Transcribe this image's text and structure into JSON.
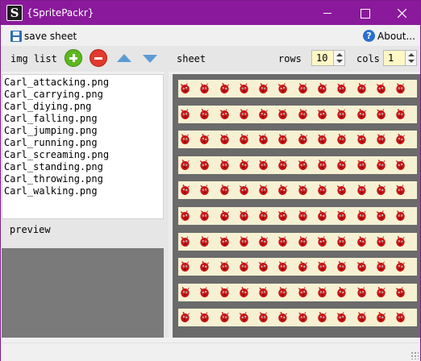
{
  "window": {
    "title": "{SpritePackr}",
    "app_icon_letter": "S"
  },
  "menubar": {
    "save_label": "save sheet",
    "about_label": "About..."
  },
  "toolbar": {
    "img_list_label": "img list",
    "sheet_label": "sheet",
    "rows_label": "rows",
    "rows_value": "10",
    "cols_label": "cols",
    "cols_value": "1"
  },
  "file_list": [
    "Carl_attacking.png",
    "Carl_carrying.png",
    "Carl_diying.png",
    "Carl_falling.png",
    "Carl_jumping.png",
    "Carl_running.png",
    "Carl_screaming.png",
    "Carl_standing.png",
    "Carl_throwing.png",
    "Carl_walking.png"
  ],
  "preview": {
    "label": "preview"
  },
  "sheet": {
    "strip_count": 10,
    "frames_per_strip": 12
  },
  "colors": {
    "titlebar": "#8a1a9b",
    "sprite": "#c81414",
    "strip_bg": "#f7f1d4",
    "sheet_bg": "#6b6b6b",
    "spin_bg": "#fff8c6"
  },
  "icons": {
    "save": "floppy-disk-icon",
    "help": "help-icon",
    "add": "add-icon",
    "remove": "remove-icon",
    "up": "move-up-icon",
    "down": "move-down-icon"
  }
}
